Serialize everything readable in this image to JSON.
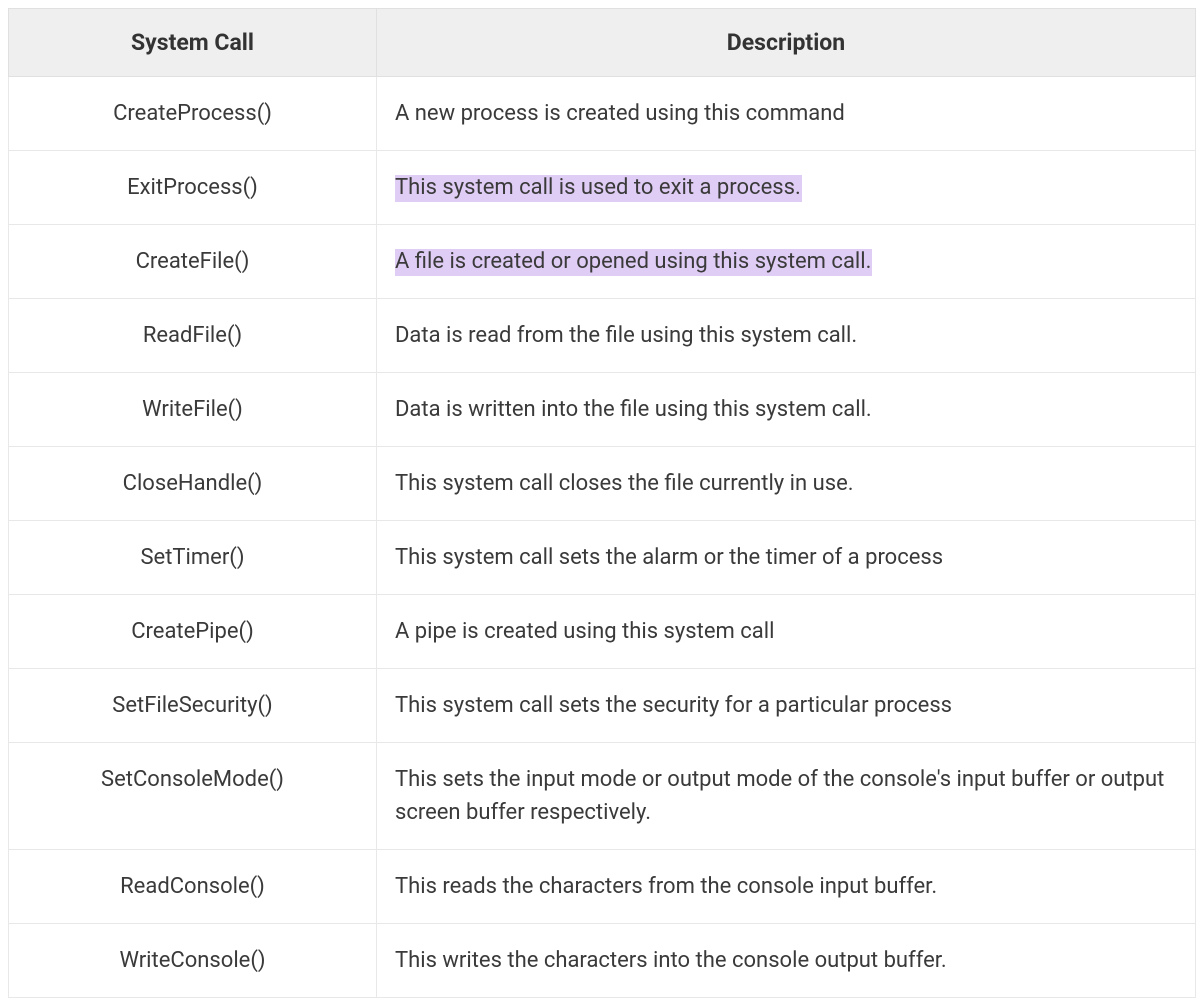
{
  "chart_data": {
    "type": "table",
    "columns": [
      "System Call",
      "Description"
    ],
    "rows": [
      {
        "syscall": "CreateProcess()",
        "description": "A new process is created using this command",
        "highlighted": false
      },
      {
        "syscall": "ExitProcess()",
        "description": "This system call is used to exit a process.",
        "highlighted": true
      },
      {
        "syscall": "CreateFile()",
        "description": "A file is created or opened using this system call.",
        "highlighted": true
      },
      {
        "syscall": "ReadFile()",
        "description": "Data is read from the file using this system call.",
        "highlighted": false
      },
      {
        "syscall": "WriteFile()",
        "description": "Data is written into the file using this system call.",
        "highlighted": false
      },
      {
        "syscall": "CloseHandle()",
        "description": "This system call closes the file currently in use.",
        "highlighted": false
      },
      {
        "syscall": "SetTimer()",
        "description": "This system call sets the alarm or the timer of a process",
        "highlighted": false
      },
      {
        "syscall": "CreatePipe()",
        "description": "A pipe is created using this system call",
        "highlighted": false
      },
      {
        "syscall": "SetFileSecurity()",
        "description": "This system call sets the security for a particular process",
        "highlighted": false
      },
      {
        "syscall": "SetConsoleMode()",
        "description": "This sets the input mode or output mode of the console's input buffer or output screen buffer respectively.",
        "highlighted": false
      },
      {
        "syscall": "ReadConsole()",
        "description": "This reads the characters from the console input buffer.",
        "highlighted": false
      },
      {
        "syscall": "WriteConsole()",
        "description": "This writes the characters into the console output buffer.",
        "highlighted": false
      }
    ]
  },
  "colors": {
    "highlight_bg": "#e0cdf5",
    "header_bg": "#efefef",
    "border": "#e5e5e5"
  }
}
